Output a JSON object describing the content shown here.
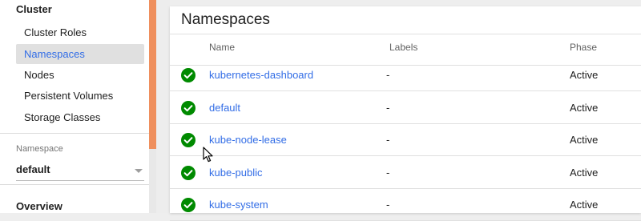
{
  "sidebar": {
    "cluster_heading": "Cluster",
    "items": [
      {
        "label": "Cluster Roles"
      },
      {
        "label": "Namespaces"
      },
      {
        "label": "Nodes"
      },
      {
        "label": "Persistent Volumes"
      },
      {
        "label": "Storage Classes"
      }
    ],
    "namespace_label": "Namespace",
    "namespace_value": "default",
    "overview_heading": "Overview"
  },
  "main": {
    "title": "Namespaces",
    "columns": {
      "name": "Name",
      "labels": "Labels",
      "phase": "Phase"
    },
    "rows": [
      {
        "status_icon": "check-circle-icon",
        "name": "kubernetes-dashboard",
        "labels": "-",
        "phase": "Active"
      },
      {
        "status_icon": "check-circle-icon",
        "name": "default",
        "labels": "-",
        "phase": "Active"
      },
      {
        "status_icon": "check-circle-icon",
        "name": "kube-node-lease",
        "labels": "-",
        "phase": "Active"
      },
      {
        "status_icon": "check-circle-icon",
        "name": "kube-public",
        "labels": "-",
        "phase": "Active"
      },
      {
        "status_icon": "check-circle-icon",
        "name": "kube-system",
        "labels": "-",
        "phase": "Active"
      }
    ]
  },
  "colors": {
    "accent": "#326de6",
    "success": "#008a00",
    "scroll_thumb": "#ef8f5d"
  }
}
